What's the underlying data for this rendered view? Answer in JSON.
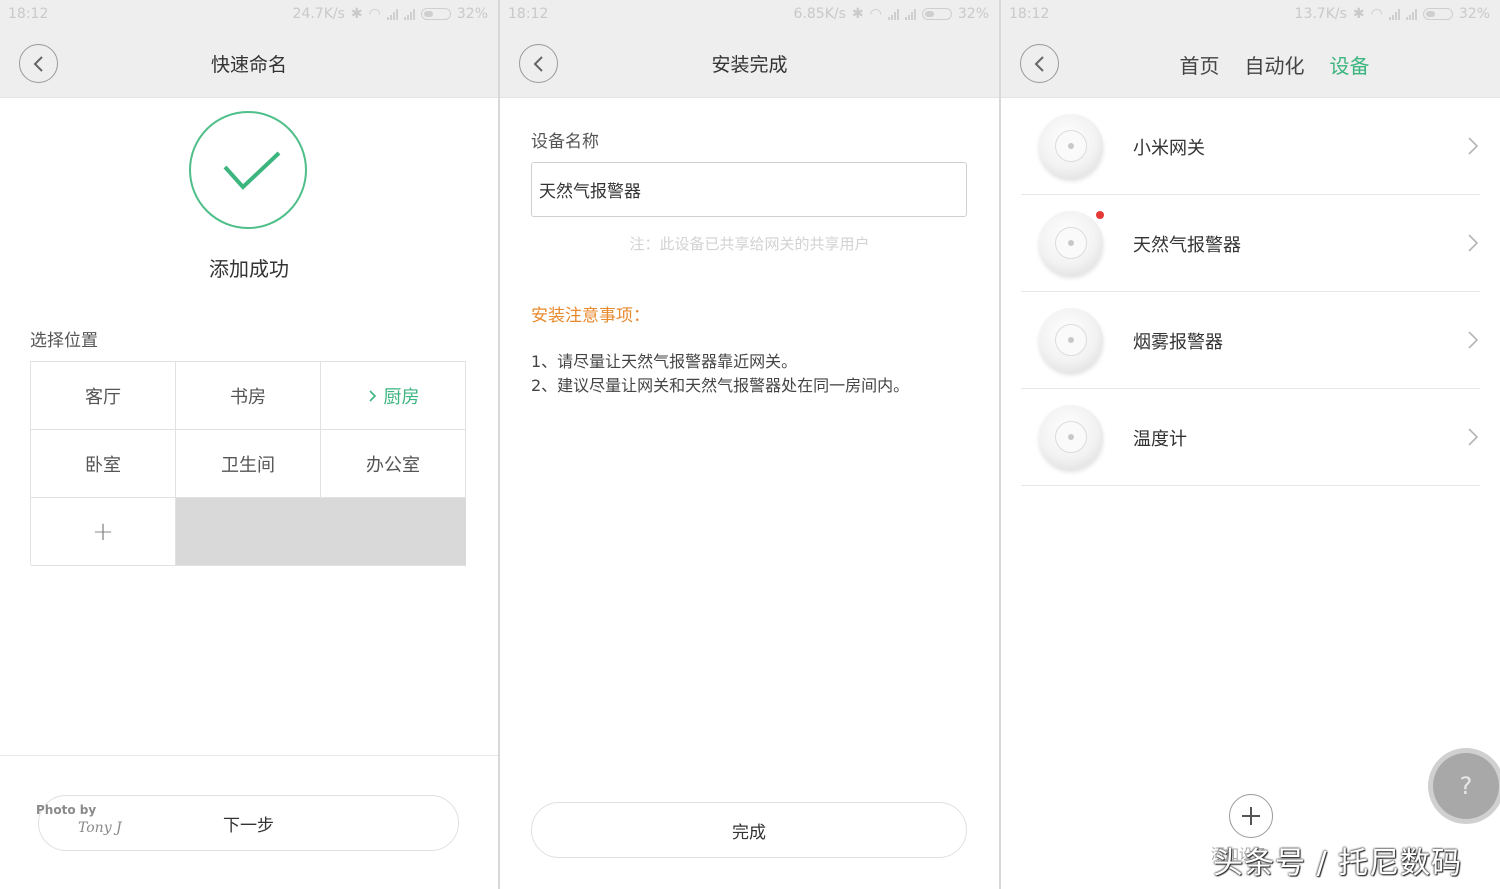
{
  "panel1": {
    "status": {
      "time": "18:12",
      "speed": "24.7K/s",
      "battery": "32%"
    },
    "header_title": "快速命名",
    "success_text": "添加成功",
    "location_label": "选择位置",
    "rooms": [
      "客厅",
      "书房",
      "厨房",
      "卧室",
      "卫生间",
      "办公室"
    ],
    "selected_room": "厨房",
    "add_room_label": "+",
    "next_button": "下一步",
    "watermark_photo": "Photo by",
    "watermark_signature": "Tony J"
  },
  "panel2": {
    "status": {
      "time": "18:12",
      "speed": "6.85K/s",
      "battery": "32%"
    },
    "header_title": "安装完成",
    "field_label": "设备名称",
    "device_name_value": "天然气报警器",
    "note": "注：此设备已共享给网关的共享用户",
    "notice_title": "安装注意事项：",
    "notice_lines": [
      "1、请尽量让天然气报警器靠近网关。",
      "2、建议尽量让网关和天然气报警器处在同一房间内。"
    ],
    "done_button": "完成"
  },
  "panel3": {
    "status": {
      "time": "18:12",
      "speed": "13.7K/s",
      "battery": "32%"
    },
    "tabs": [
      "首页",
      "自动化",
      "设备"
    ],
    "active_tab": "设备",
    "devices": [
      {
        "name": "小米网关",
        "icon": "gateway-device-icon"
      },
      {
        "name": "天然气报警器",
        "icon": "gas-alarm-device-icon",
        "new": true
      },
      {
        "name": "烟雾报警器",
        "icon": "smoke-alarm-device-icon"
      },
      {
        "name": "温度计",
        "icon": "thermometer-device-icon"
      }
    ],
    "add_device_label": "添加设备",
    "help_icon": "?"
  },
  "overlay_watermark": "头条号 / 托尼数码",
  "colors": {
    "accent_green": "#3db57f",
    "success_circle": "#4fbf8a",
    "notice_orange": "#e88a2e",
    "new_badge_red": "#e53935",
    "header_bg": "#eeeeee"
  }
}
